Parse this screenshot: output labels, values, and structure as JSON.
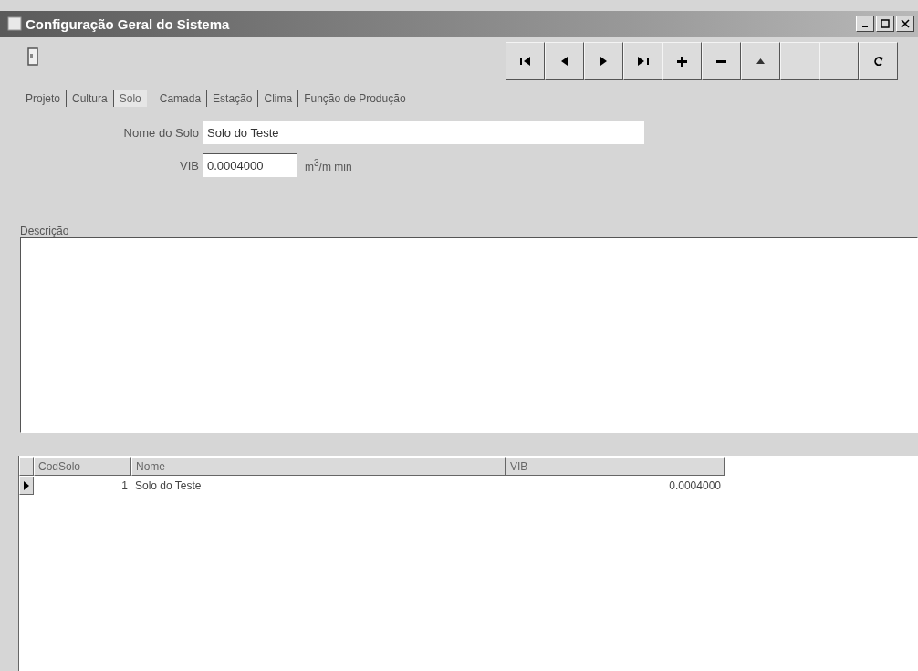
{
  "window": {
    "title": "Configuração Geral do Sistema"
  },
  "toolbar": {
    "buttons": [
      {
        "kind": "first"
      },
      {
        "kind": "prior"
      },
      {
        "kind": "next"
      },
      {
        "kind": "last"
      },
      {
        "kind": "insert"
      },
      {
        "kind": "delete"
      },
      {
        "kind": "edit"
      },
      {
        "kind": "post"
      },
      {
        "kind": "cancel"
      },
      {
        "kind": "refresh"
      }
    ]
  },
  "tabs": [
    {
      "label": "Projeto",
      "selected": false
    },
    {
      "label": "Cultura",
      "selected": false
    },
    {
      "label": "Solo",
      "selected": true
    },
    {
      "label": "Camada",
      "selected": false
    },
    {
      "label": "Estação",
      "selected": false
    },
    {
      "label": "Clima",
      "selected": false
    },
    {
      "label": "Função de Produção",
      "selected": false
    }
  ],
  "form": {
    "soil_name": {
      "label": "Nome do Solo",
      "value": "Solo do Teste"
    },
    "vib": {
      "label": "VIB",
      "value": "0.0004000",
      "unit": "m$^{3}$/m min"
    },
    "description": {
      "label": "Descrição"
    }
  },
  "table": {
    "columns": [
      "CodSolo",
      "Nome",
      "VIB"
    ],
    "rows": [
      {
        "selected": true,
        "cells": [
          "1",
          "Solo do Teste",
          "0.0004000"
        ]
      }
    ]
  }
}
